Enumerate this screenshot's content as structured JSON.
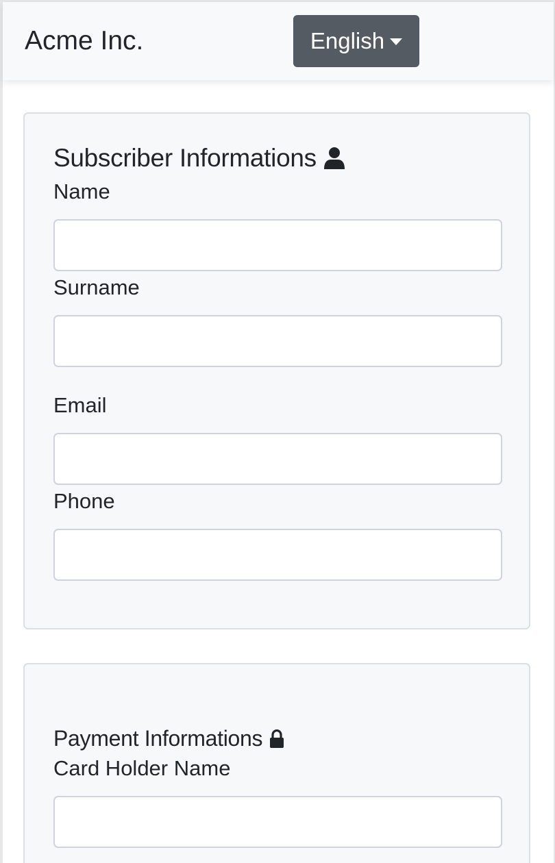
{
  "navbar": {
    "brand": "Acme Inc.",
    "language_label": "English"
  },
  "subscriber": {
    "title": "Subscriber Informations",
    "title_icon": "user-icon",
    "fields": {
      "name": {
        "label": "Name",
        "value": ""
      },
      "surname": {
        "label": "Surname",
        "value": ""
      },
      "email": {
        "label": "Email",
        "value": ""
      },
      "phone": {
        "label": "Phone",
        "value": ""
      }
    }
  },
  "payment": {
    "title": "Payment Informations",
    "title_icon": "lock-icon",
    "fields": {
      "card_holder_name": {
        "label": "Card Holder Name",
        "value": ""
      }
    }
  },
  "colors": {
    "navbar_bg": "#f8f9fa",
    "button_bg": "#545b62",
    "card_bg": "#f7f8fa",
    "card_border": "#dcdfe3",
    "input_border": "#ced4da",
    "text": "#212529"
  }
}
